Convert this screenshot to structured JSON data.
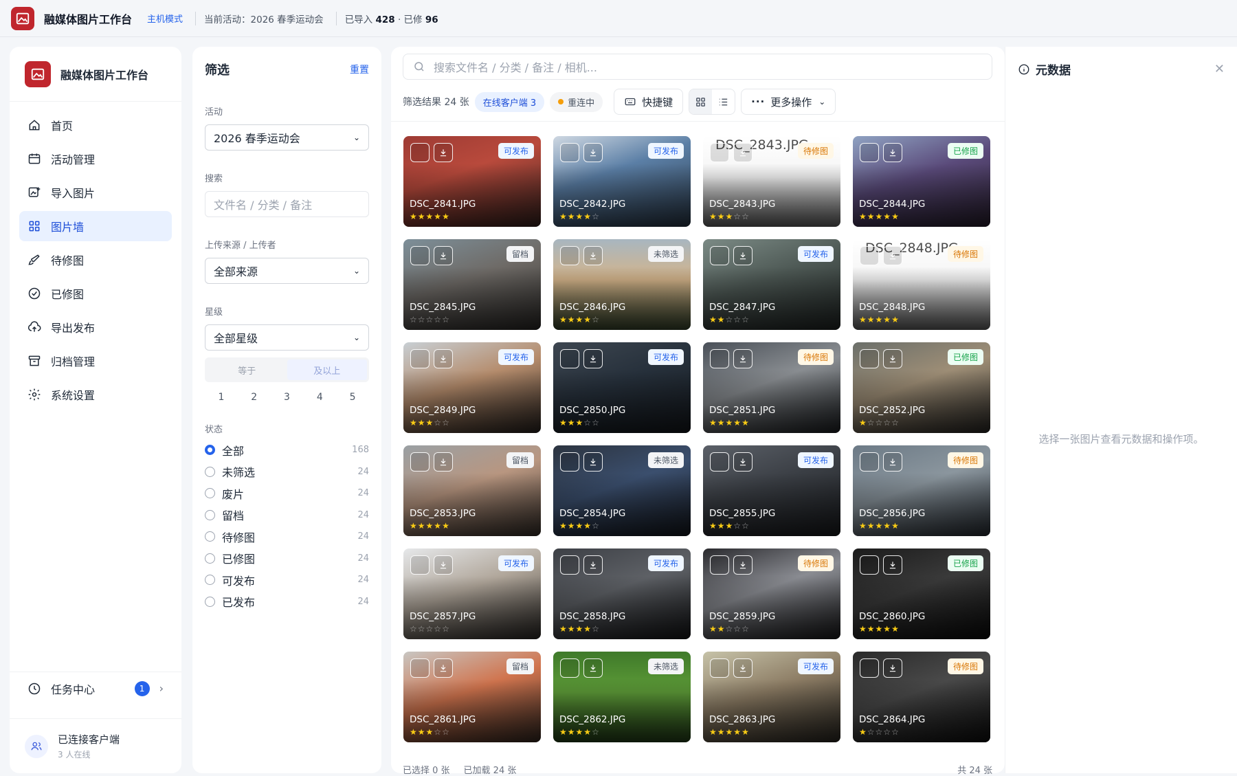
{
  "topbar": {
    "title": "融媒体图片工作台",
    "mode": "主机模式",
    "activity": "当前活动：2026 春季运动会",
    "counts_prefix_1": "已导入",
    "imported": "428",
    "counts_sep": "· 已修",
    "retouched": "96"
  },
  "nav": {
    "title": "融媒体图片工作台",
    "items": [
      {
        "label": "首页",
        "icon": "home-icon"
      },
      {
        "label": "活动管理",
        "icon": "calendar-icon"
      },
      {
        "label": "导入图片",
        "icon": "image-add-icon"
      },
      {
        "label": "图片墙",
        "icon": "grid-icon"
      },
      {
        "label": "待修图",
        "icon": "brush-icon"
      },
      {
        "label": "已修图",
        "icon": "check-circle-icon"
      },
      {
        "label": "导出发布",
        "icon": "upload-cloud-icon"
      },
      {
        "label": "归档管理",
        "icon": "archive-icon"
      },
      {
        "label": "系统设置",
        "icon": "gear-icon"
      }
    ],
    "task_center": "任务中心",
    "task_badge": "1",
    "connection": "已连接客户端",
    "online": "3 人在线"
  },
  "filter": {
    "title": "筛选",
    "reset": "重置",
    "activity_label": "活动",
    "activity_value": "2026 春季运动会",
    "search_label": "搜索",
    "search_placeholder": "文件名 / 分类 / 备注",
    "source_label": "上传来源 / 上传者",
    "source_value": "全部来源",
    "rating_label": "星级",
    "rating_value": "全部星级",
    "mode_equal": "等于",
    "mode_above": "及以上",
    "stars": [
      "1",
      "2",
      "3",
      "4",
      "5"
    ],
    "status_label": "状态",
    "statuses": [
      {
        "label": "全部",
        "count": "168"
      },
      {
        "label": "未筛选",
        "count": "24"
      },
      {
        "label": "废片",
        "count": "24"
      },
      {
        "label": "留档",
        "count": "24"
      },
      {
        "label": "待修图",
        "count": "24"
      },
      {
        "label": "已修图",
        "count": "24"
      },
      {
        "label": "可发布",
        "count": "24"
      },
      {
        "label": "已发布",
        "count": "24"
      }
    ]
  },
  "main": {
    "search_placeholder": "搜索文件名 / 分类 / 备注 / 相机...",
    "result": "筛选结果 24 张",
    "online_clients": "在线客户端 3",
    "reconnecting": "重连中",
    "shortcut": "快捷键",
    "more": "更多操作",
    "selected": "已选择 0 张",
    "loaded": "已加载 24 张",
    "total": "共 24 张"
  },
  "photos": [
    {
      "name": "DSC_2841.JPG",
      "tag": "可发布",
      "tagtype": "pub",
      "stars": 5,
      "bg": "linear-gradient(160deg,#9e3b34 0%,#b94a3c 40%,#3a2420 100%)"
    },
    {
      "name": "DSC_2842.JPG",
      "tag": "可发布",
      "tagtype": "pub",
      "stars": 4,
      "bg": "linear-gradient(160deg,#cfd8e2 0%,#5b7fa6 40%,#2b3a4a 100%)"
    },
    {
      "name": "DSC_2843.JPG",
      "tag": "待修图",
      "tagtype": "todo",
      "stars": 3,
      "bg": "linear-gradient(180deg,#ffffff 0%,#f4f4f4 45%,#6b6b6b 100%)",
      "ghost": "DSC_2843.JPG"
    },
    {
      "name": "DSC_2844.JPG",
      "tag": "已修图",
      "tagtype": "done",
      "stars": 5,
      "bg": "linear-gradient(160deg,#8fa2c2 0%,#5a4a7a 45%,#2a2030 100%)"
    },
    {
      "name": "DSC_2845.JPG",
      "tag": "留档",
      "tagtype": "keep",
      "stars": 0,
      "bg": "linear-gradient(160deg,#7d8f99 0%,#6e6a66 45%,#2e2c2a 100%)"
    },
    {
      "name": "DSC_2846.JPG",
      "tag": "未筛选",
      "tagtype": "new",
      "stars": 4,
      "bg": "linear-gradient(180deg,#a8b6c0 0%,#d4b48a 45%,#3b4a30 100%)"
    },
    {
      "name": "DSC_2847.JPG",
      "tag": "可发布",
      "tagtype": "pub",
      "stars": 2,
      "bg": "linear-gradient(160deg,#7b8a85 0%,#4d5854 45%,#232827 100%)"
    },
    {
      "name": "DSC_2848.JPG",
      "tag": "待修图",
      "tagtype": "todo",
      "stars": 5,
      "bg": "linear-gradient(180deg,#ffffff 0%,#f4f4f4 45%,#6b6b6b 100%)",
      "ghost": "DSC_2848.JPG"
    },
    {
      "name": "DSC_2849.JPG",
      "tag": "可发布",
      "tagtype": "pub",
      "stars": 3,
      "bg": "linear-gradient(160deg,#c8cfd4 0%,#b58c6c 45%,#2d2622 100%)"
    },
    {
      "name": "DSC_2850.JPG",
      "tag": "可发布",
      "tagtype": "pub",
      "stars": 3,
      "bg": "linear-gradient(160deg,#3d4650 0%,#26303b 45%,#15191e 100%)"
    },
    {
      "name": "DSC_2851.JPG",
      "tag": "待修图",
      "tagtype": "todo",
      "stars": 5,
      "bg": "linear-gradient(160deg,#4a5058 0%,#8a8e92 45%,#202326 100%)"
    },
    {
      "name": "DSC_2852.JPG",
      "tag": "已修图",
      "tagtype": "done",
      "stars": 1,
      "bg": "linear-gradient(160deg,#6b6f6a 0%,#9e8e76 45%,#2c2a27 100%)"
    },
    {
      "name": "DSC_2853.JPG",
      "tag": "留档",
      "tagtype": "keep",
      "stars": 5,
      "bg": "linear-gradient(160deg,#9aa0a4 0%,#b89680 45%,#3a322c 100%)"
    },
    {
      "name": "DSC_2854.JPG",
      "tag": "未筛选",
      "tagtype": "new",
      "stars": 4,
      "bg": "linear-gradient(160deg,#2c3440 0%,#3b4f6e 45%,#151920 100%)"
    },
    {
      "name": "DSC_2855.JPG",
      "tag": "可发布",
      "tagtype": "pub",
      "stars": 3,
      "bg": "linear-gradient(160deg,#5b6068 0%,#3a3e44 45%,#1a1c1f 100%)"
    },
    {
      "name": "DSC_2856.JPG",
      "tag": "待修图",
      "tagtype": "todo",
      "stars": 5,
      "bg": "linear-gradient(160deg,#6c7a86 0%,#8b969e 45%,#2b3138 100%)"
    },
    {
      "name": "DSC_2857.JPG",
      "tag": "可发布",
      "tagtype": "pub",
      "stars": 0,
      "bg": "linear-gradient(160deg,#e6e8ea 0%,#b0a69a 45%,#2f2c29 100%)"
    },
    {
      "name": "DSC_2858.JPG",
      "tag": "可发布",
      "tagtype": "pub",
      "stars": 4,
      "bg": "linear-gradient(160deg,#3d4046 0%,#5e6166 45%,#17181a 100%)"
    },
    {
      "name": "DSC_2859.JPG",
      "tag": "待修图",
      "tagtype": "todo",
      "stars": 2,
      "bg": "linear-gradient(160deg,#2a2a2e 0%,#8a8c92 45%,#1c1c1e 100%)"
    },
    {
      "name": "DSC_2860.JPG",
      "tag": "已修图",
      "tagtype": "done",
      "stars": 5,
      "bg": "linear-gradient(160deg,#1c1c1c 0%,#3a3a3a 45%,#0c0c0c 100%)"
    },
    {
      "name": "DSC_2861.JPG",
      "tag": "留档",
      "tagtype": "keep",
      "stars": 3,
      "bg": "linear-gradient(160deg,#c8c6c2 0%,#d0744e 45%,#3a2c24 100%)"
    },
    {
      "name": "DSC_2862.JPG",
      "tag": "未筛选",
      "tagtype": "new",
      "stars": 4,
      "bg": "linear-gradient(180deg,#3f7a2a 0%,#5e9c38 45%,#26441a 100%)"
    },
    {
      "name": "DSC_2863.JPG",
      "tag": "可发布",
      "tagtype": "pub",
      "stars": 5,
      "bg": "linear-gradient(160deg,#c6c2a8 0%,#8c7c64 45%,#2d2a24 100%)"
    },
    {
      "name": "DSC_2864.JPG",
      "tag": "待修图",
      "tagtype": "todo",
      "stars": 1,
      "bg": "linear-gradient(160deg,#2a2a2a 0%,#4a4a4a 45%,#0e0e0e 100%)"
    }
  ],
  "meta": {
    "title": "元数据",
    "empty": "选择一张图片查看元数据和操作项。"
  }
}
